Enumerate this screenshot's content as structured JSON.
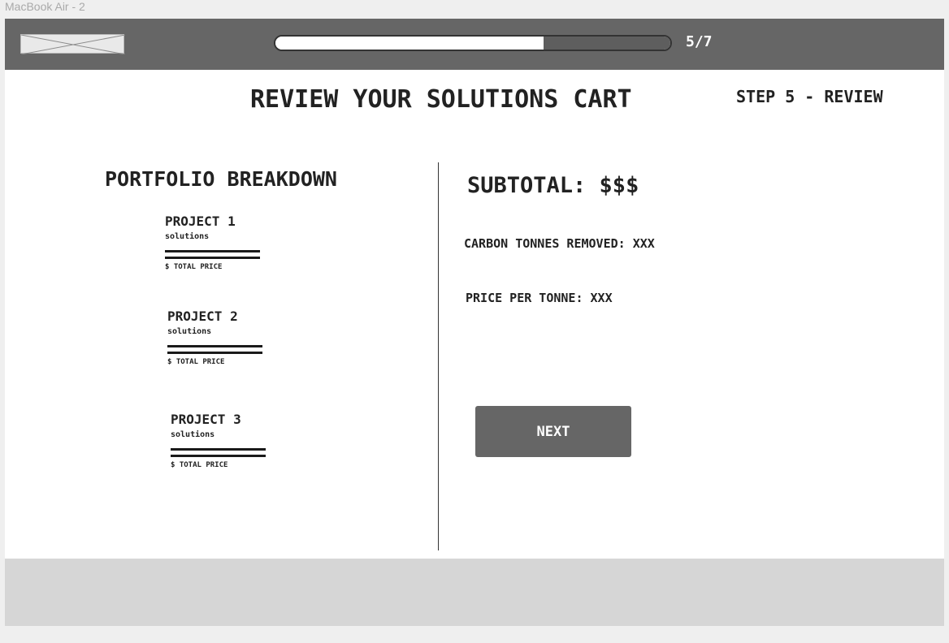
{
  "frame": {
    "label": "MacBook Air - 2"
  },
  "header": {
    "logo_icon": "image-placeholder-icon",
    "progress": {
      "current": 5,
      "total": 7,
      "fraction": 0.68,
      "label": "5/7"
    }
  },
  "page": {
    "title": "REVIEW YOUR SOLUTIONS CART",
    "step": "STEP 5 - REVIEW"
  },
  "portfolio": {
    "title": "PORTFOLIO BREAKDOWN",
    "projects": [
      {
        "name": "PROJECT 1",
        "subtitle": "solutions",
        "price_label": "$ TOTAL PRICE"
      },
      {
        "name": "PROJECT 2",
        "subtitle": "solutions",
        "price_label": "$ TOTAL PRICE"
      },
      {
        "name": "PROJECT 3",
        "subtitle": "solutions",
        "price_label": "$ TOTAL PRICE"
      }
    ]
  },
  "summary": {
    "subtotal": "SUBTOTAL: $$$",
    "carbon_removed": "CARBON TONNES REMOVED: XXX",
    "price_per_tonne": "PRICE PER TONNE: XXX",
    "next_label": "NEXT"
  },
  "colors": {
    "topbar": "#666666",
    "footer": "#d6d6d6",
    "button": "#666666"
  }
}
